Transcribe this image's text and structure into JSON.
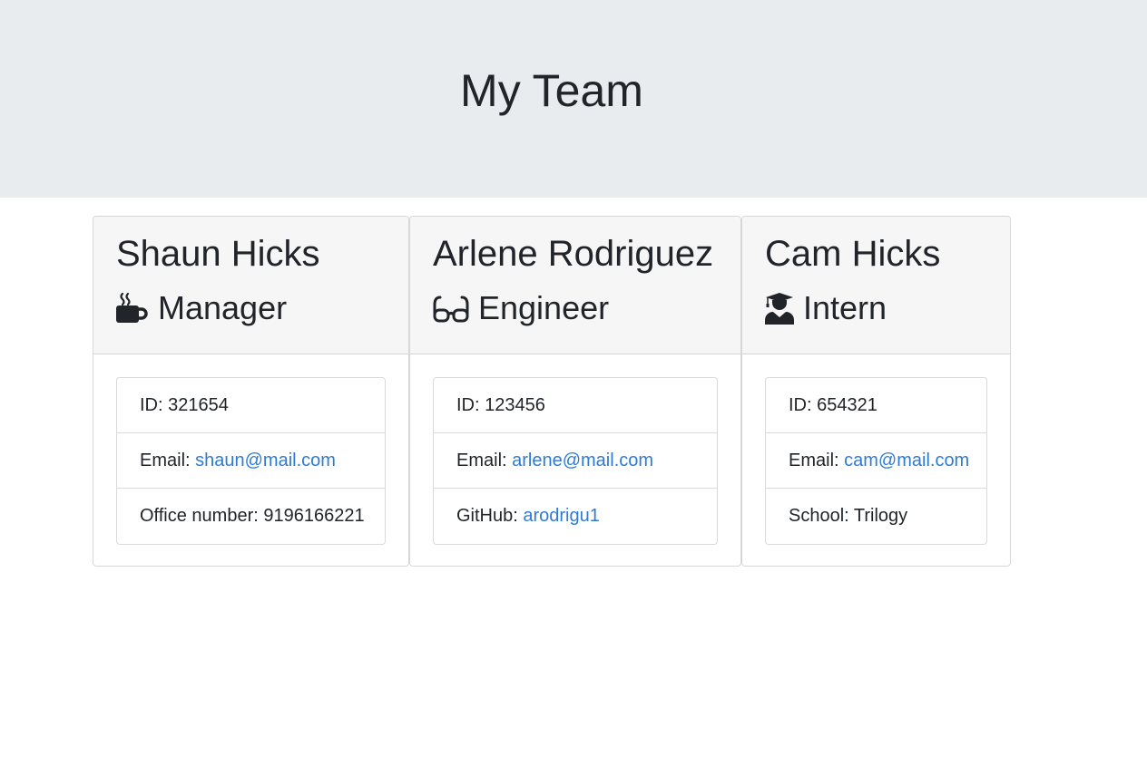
{
  "header": {
    "title": "My Team"
  },
  "employees": [
    {
      "name": "Shaun Hicks",
      "role": "Manager",
      "role_icon": "mug-hot-icon",
      "id_label": "ID: ",
      "id_value": "321654",
      "email_label": "Email: ",
      "email": "shaun@mail.com",
      "extra_label": "Office number: ",
      "extra_value": "9196166221"
    },
    {
      "name": "Arlene Rodriguez",
      "role": "Engineer",
      "role_icon": "glasses-icon",
      "id_label": "ID: ",
      "id_value": "123456",
      "email_label": "Email: ",
      "email": "arlene@mail.com",
      "extra_label": "GitHub: ",
      "extra_value": "arodrigu1"
    },
    {
      "name": "Cam Hicks",
      "role": "Intern",
      "role_icon": "user-graduate-icon",
      "id_label": "ID: ",
      "id_value": "654321",
      "email_label": "Email: ",
      "email": "cam@mail.com",
      "extra_label": "School: ",
      "extra_value": "Trilogy"
    }
  ],
  "colors": {
    "link": "#2e7bd6",
    "jumbotron_bg": "#e9ecef",
    "card_header_bg": "#f6f6f6",
    "text": "#212529"
  }
}
